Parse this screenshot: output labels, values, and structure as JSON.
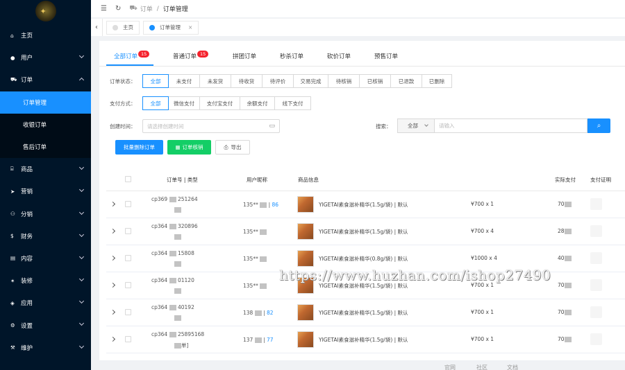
{
  "sidebar": {
    "logo_glyph": "✦",
    "items": [
      {
        "icon": "⌂",
        "label": "主页",
        "chev": false
      },
      {
        "icon": "●",
        "label": "用户",
        "chev": true
      },
      {
        "icon": "⛟",
        "label": "订单",
        "chev": true,
        "open": true
      },
      {
        "icon": "⌸",
        "label": "商品",
        "chev": true
      },
      {
        "icon": "➤",
        "label": "营销",
        "chev": true
      },
      {
        "icon": "⚇",
        "label": "分销",
        "chev": true
      },
      {
        "icon": "$",
        "label": "财务",
        "chev": true
      },
      {
        "icon": "▤",
        "label": "内容",
        "chev": true
      },
      {
        "icon": "✶",
        "label": "装修",
        "chev": true
      },
      {
        "icon": "◈",
        "label": "应用",
        "chev": true
      },
      {
        "icon": "⚙",
        "label": "设置",
        "chev": true
      },
      {
        "icon": "⚒",
        "label": "维护",
        "chev": true
      }
    ],
    "order_sub": [
      "订单管理",
      "收银订单",
      "售后订单"
    ]
  },
  "topbar": {
    "menu_icon": "☰",
    "refresh_icon": "↻",
    "cart_icon": "⛟",
    "crumb1": "订单",
    "sep": "/",
    "crumb2": "订单管理"
  },
  "tagsbar": {
    "arrow": "‹",
    "tag1": "主页",
    "tag2": "订单管理",
    "close": "×"
  },
  "tabs": [
    {
      "label": "全部订单",
      "badge": "15"
    },
    {
      "label": "普通订单",
      "badge": "15"
    },
    {
      "label": "拼团订单"
    },
    {
      "label": "秒杀订单"
    },
    {
      "label": "砍价订单"
    },
    {
      "label": "预售订单"
    }
  ],
  "filters": {
    "status_label": "订单状态：",
    "status_options": [
      "全部",
      "未支付",
      "未发货",
      "待收货",
      "待评价",
      "交易完成",
      "待核销",
      "已核销",
      "已退款",
      "已删除"
    ],
    "pay_label": "支付方式：",
    "pay_options": [
      "全部",
      "微信支付",
      "支付宝支付",
      "余额支付",
      "线下支付"
    ],
    "time_label": "创建时间：",
    "time_placeholder": "请选择创建时间",
    "search_label": "搜索：",
    "search_scope": "全部",
    "search_placeholder": "请输入",
    "search_icon": "⌕"
  },
  "actions": {
    "batch_delete": "批量删除订单",
    "verify": "订单核销",
    "export": "导出",
    "verify_icon": "▦",
    "export_icon": "⎙"
  },
  "table": {
    "headers": {
      "order": "订单号 | 类型",
      "user": "用户昵称",
      "product": "商品信息",
      "pay": "实际支付",
      "proof": "支付证明"
    },
    "rows": [
      {
        "order_no": "cp369",
        "order_mid": "251264",
        "type": "",
        "user": "135**",
        "uid": "86",
        "product": "YIGETAI素食滋补精华(1.5g/袋) | 默认",
        "price": "¥700 x 1",
        "pay": "70"
      },
      {
        "order_no": "cp364",
        "order_mid": "320896",
        "type": "",
        "user": "135**",
        "uid": "",
        "product": "YIGETAI素食滋补精华(1.5g/袋) | 默认",
        "price": "¥700 x 4",
        "pay": "28"
      },
      {
        "order_no": "cp364",
        "order_mid": "15808",
        "type": "",
        "user": "135**",
        "uid": "",
        "product": "YIGETAI素食滋补精华(0.8g/袋) | 默认",
        "price": "¥1000 x 4",
        "pay": "40"
      },
      {
        "order_no": "cp364",
        "order_mid": "01120",
        "type": "",
        "user": "135**",
        "uid": "",
        "product": "YIGETAI素食滋补精华(1.5g/袋) | 默认",
        "price": "¥700 x 1",
        "pay": "70"
      },
      {
        "order_no": "cp364",
        "order_mid": "40192",
        "type": "",
        "user": "138",
        "uid": "82",
        "product": "YIGETAI素食滋补精华(1.5g/袋) | 默认",
        "price": "¥700 x 1",
        "pay": "70"
      },
      {
        "order_no": "cp364",
        "order_mid": "25895168",
        "type": "单]",
        "user": "137",
        "uid": "77",
        "product": "YIGETAI素食滋补精华(1.5g/袋) | 默认",
        "price": "¥700 x 1",
        "pay": "70"
      }
    ]
  },
  "footer": {
    "links": [
      "官网",
      "社区",
      "文档"
    ]
  },
  "watermark": "https://www.huzhan.com/ishop27490"
}
